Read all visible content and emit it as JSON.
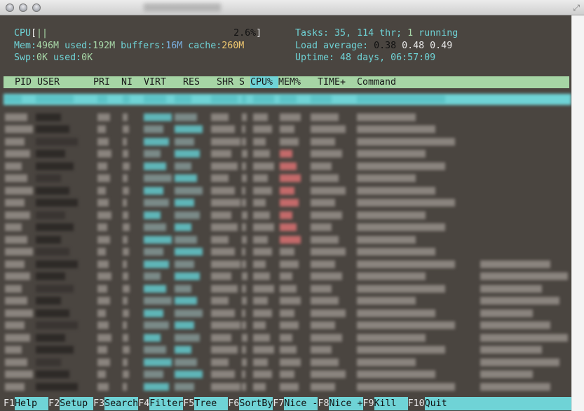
{
  "window": {
    "buttons": [
      "close",
      "minimize",
      "zoom"
    ]
  },
  "meters": {
    "cpu_label": "CPU",
    "cpu_open": "[",
    "cpu_bar": "||",
    "cpu_value": "2.6%",
    "cpu_close": "]",
    "mem_label": "Mem:",
    "mem_total": "496M",
    "used_label": " used:",
    "mem_used": "192M",
    "buffers_label": " buffers:",
    "buffers": "16M",
    "cache_label": " cache:",
    "cache": "260M",
    "swp_label": "Swp:",
    "swp_total": "0K",
    "swp_used_label": " used:",
    "swp_used": "0K",
    "tasks_label": "Tasks: ",
    "tasks": "35",
    "tasks_sep": ", ",
    "threads": "114",
    "thr_label": " thr; ",
    "running": "1",
    "running_label": " running",
    "load_label": "Load average: ",
    "load1": "0.38",
    "load5": "0.48",
    "load15": "0.49",
    "uptime_label": "Uptime: ",
    "uptime": "48 days, 06:57:09"
  },
  "columns": [
    "PID",
    "USER",
    "PRI",
    "NI",
    "VIRT",
    "RES",
    "SHR",
    "S",
    "CPU%",
    "MEM%",
    "TIME+",
    "Command"
  ],
  "sorted_column": "CPU%",
  "footer": [
    {
      "key": "F1",
      "label": "Help  "
    },
    {
      "key": "F2",
      "label": "Setup "
    },
    {
      "key": "F3",
      "label": "Search"
    },
    {
      "key": "F4",
      "label": "Filter"
    },
    {
      "key": "F5",
      "label": "Tree  "
    },
    {
      "key": "F6",
      "label": "SortBy"
    },
    {
      "key": "F7",
      "label": "Nice -"
    },
    {
      "key": "F8",
      "label": "Nice +"
    },
    {
      "key": "F9",
      "label": "Kill  "
    },
    {
      "key": "F10",
      "label": "Quit"
    }
  ],
  "colors": {
    "bg": "#4a4540",
    "cyan": "#6fd3d6",
    "green": "#a6d5a5"
  }
}
